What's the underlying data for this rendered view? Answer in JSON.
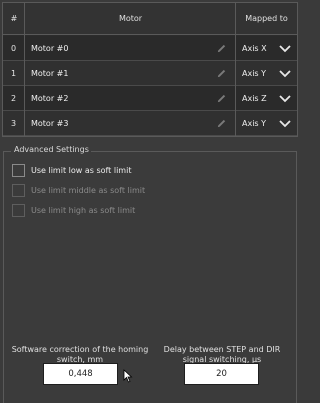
{
  "table": {
    "headers": {
      "num": "#",
      "motor": "Motor",
      "axis": "Mapped to Axis"
    },
    "rows": [
      {
        "num": "0",
        "name": "Motor #0",
        "axis": "Axis X"
      },
      {
        "num": "1",
        "name": "Motor #1",
        "axis": "Axis Y"
      },
      {
        "num": "2",
        "name": "Motor #2",
        "axis": "Axis Z"
      },
      {
        "num": "3",
        "name": "Motor #3",
        "axis": "Axis Y"
      }
    ]
  },
  "advanced": {
    "title": "Advanced Settings",
    "options": [
      {
        "label": "Use limit low as soft limit",
        "enabled": true,
        "checked": false
      },
      {
        "label": "Use limit middle as soft limit",
        "enabled": false,
        "checked": false
      },
      {
        "label": "Use limit high as soft limit",
        "enabled": false,
        "checked": false
      }
    ],
    "fields": [
      {
        "label_line1": "Software correction of the homing",
        "label_line2": "switch, mm",
        "value": "0,448"
      },
      {
        "label_line1": "Delay between STEP and DIR",
        "label_line2": "signal switching, µs",
        "value": "20"
      }
    ]
  },
  "icons": {
    "edit": "pencil-icon",
    "dropdown": "chevron-down-icon",
    "cursor": "mouse-pointer-icon"
  },
  "colors": {
    "background": "#3b3b3b",
    "table_bg": "#2c2c2c",
    "border": "#5a5a5a",
    "text": "#e8e8e8",
    "disabled_text": "#8a8a8a"
  }
}
